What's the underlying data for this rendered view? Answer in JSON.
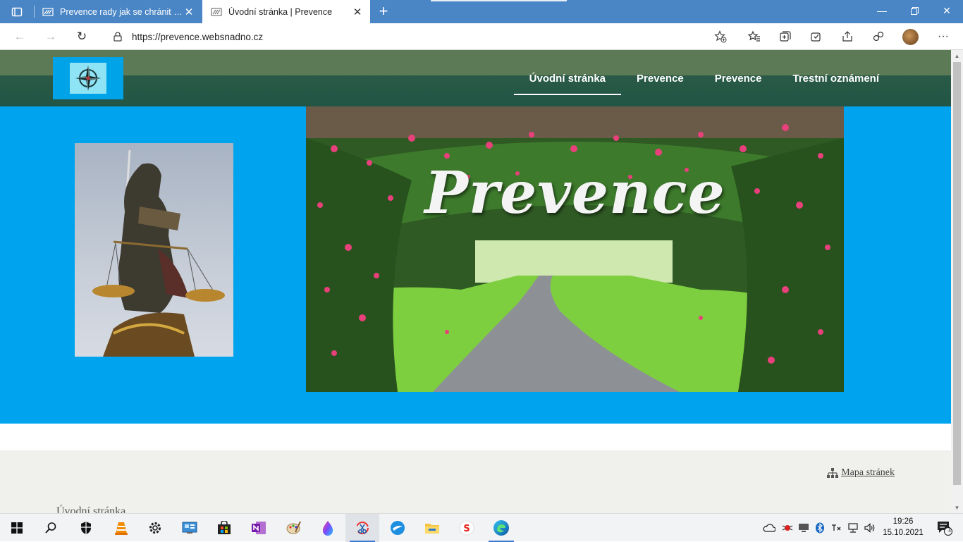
{
  "browser": {
    "tabs": [
      {
        "title": "Prevence rady jak se chránit | Mo",
        "active": false
      },
      {
        "title": "Úvodní stránka | Prevence",
        "active": true
      }
    ],
    "url": "https://prevence.websnadno.cz",
    "accent": "#4a86c5"
  },
  "site": {
    "menu": [
      {
        "label": "Úvodní stránka",
        "active": true
      },
      {
        "label": "Prevence",
        "active": false
      },
      {
        "label": "Prevence",
        "active": false
      },
      {
        "label": "Trestní oznámení",
        "active": false
      }
    ],
    "hero_title": "Prevence",
    "sitemap_label": "Mapa stránek",
    "breadcrumb": "Úvodní stránka",
    "colors": {
      "header": "#2a5a47",
      "hero": "#00a4ee",
      "footer": "#f0f1ed"
    }
  },
  "taskbar": {
    "apps": [
      "start-icon",
      "search-icon",
      "security-icon",
      "vlc-icon",
      "settings-icon",
      "control-panel-icon",
      "store-icon",
      "onenote-icon",
      "paint-icon",
      "paint3d-icon",
      "snipping-icon",
      "swift-icon",
      "file-explorer-icon",
      "s-app-icon",
      "edge-icon"
    ],
    "time": "19:26",
    "date": "15.10.2021",
    "notification_count": "1"
  }
}
